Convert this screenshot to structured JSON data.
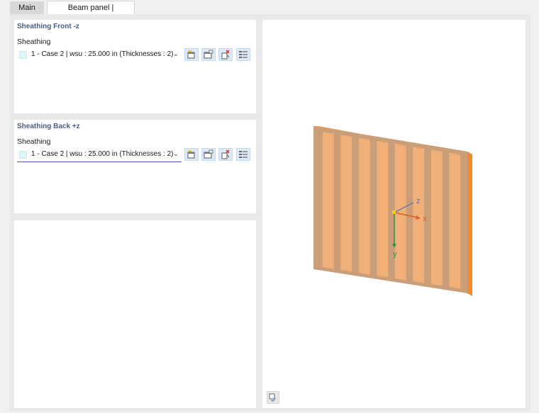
{
  "tabs": [
    {
      "label": "Main",
      "active": false
    },
    {
      "label": "Beam panel | Sheathing",
      "active": true
    }
  ],
  "front": {
    "title": "Sheathing Front -z",
    "field_label": "Sheathing",
    "combo_value": "1 - Case 2 | wsu : 25.000 in (Thicknesses : 2)",
    "swatch_color": "#dff5fb"
  },
  "back": {
    "title": "Sheathing Back +z",
    "field_label": "Sheathing",
    "combo_value": "1 - Case 2 | wsu : 25.000 in (Thicknesses : 2)",
    "swatch_color": "#dff5fb"
  },
  "buttons": {
    "icons": [
      "new-item-icon",
      "copy-item-icon",
      "delete-item-icon",
      "edit-list-icon"
    ]
  },
  "viewer": {
    "axes": {
      "x": "x",
      "y": "y",
      "z": "z"
    },
    "colors": {
      "panel_front": "#f2b079",
      "panel_frame": "#c99e79",
      "panel_edge": "#ee8c33",
      "axis_x": "#e05a2b",
      "axis_y": "#2e9a3a",
      "axis_z": "#5a6ab8",
      "origin": "#f3d000"
    },
    "stud_count": 8
  }
}
